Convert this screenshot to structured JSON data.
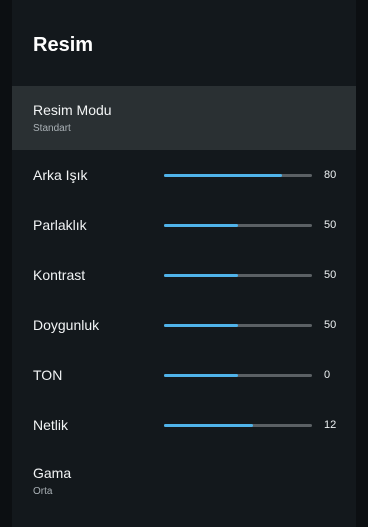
{
  "header": {
    "title": "Resim"
  },
  "picture_mode": {
    "label": "Resim Modu",
    "value": "Standart"
  },
  "sliders": [
    {
      "label": "Arka Işık",
      "value": "80",
      "level": 0.8
    },
    {
      "label": "Parlaklık",
      "value": "50",
      "level": 0.5
    },
    {
      "label": "Kontrast",
      "value": "50",
      "level": 0.5
    },
    {
      "label": "Doygunluk",
      "value": "50",
      "level": 0.5
    },
    {
      "label": "TON",
      "value": "0",
      "level": 0.5
    },
    {
      "label": "Netlik",
      "value": "12",
      "level": 0.6
    }
  ],
  "gamma": {
    "label": "Gama",
    "value": "Orta"
  },
  "colors": {
    "accent": "#4fb3ea",
    "track": "#5b6064",
    "panel": "#13181c",
    "selected_row": "#2a3033"
  }
}
